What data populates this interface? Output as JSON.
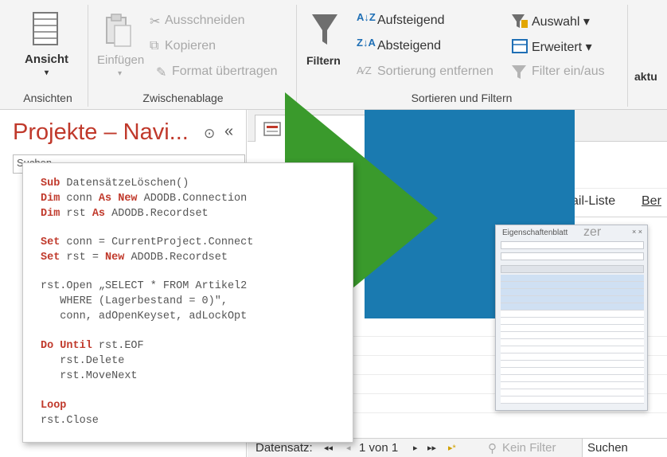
{
  "ribbon": {
    "ansicht": "Ansicht",
    "einfuegen": "Einfügen",
    "ausschneiden": "Ausschneiden",
    "kopieren": "Kopieren",
    "format_uebertragen": "Format übertragen",
    "filtern": "Filtern",
    "aufsteigend": "Aufsteigend",
    "absteigend": "Absteigend",
    "sortierung_entfernen": "Sortierung entfernen",
    "auswahl": "Auswahl ▾",
    "erweitert": "Erweitert ▾",
    "filter_ein_aus": "Filter ein/aus",
    "aktu": "aktu",
    "groups": {
      "ansichten": "Ansichten",
      "zwischenablage": "Zwischenablage",
      "sortieren_filtern": "Sortieren und Filtern"
    }
  },
  "nav": {
    "title": "Projekte – Navi...",
    "search_placeholder": "Suchen",
    "chevron": "⊙",
    "collapse": "«"
  },
  "tabs": {
    "email_liste": "ail-Liste",
    "ber": "Ber"
  },
  "statusbar": {
    "datensatz_label": "Datensatz:",
    "first": "◂◂",
    "prev": "◂",
    "position": "1 von 1",
    "next": "▸",
    "last": "▸▸",
    "new": "▸*",
    "kein_filter": "Kein Filter",
    "suchen": "Suchen"
  },
  "property_sheet": {
    "title": "Eigenschaftenblatt",
    "big_title": "zer",
    "close": "× ×"
  },
  "code": {
    "line1_kw": "Sub",
    "line1_rest": " DatensätzeLöschen()",
    "line2_kw": "Dim",
    "line2_mid": " conn ",
    "line2_kw2": "As New",
    "line2_rest": " ADODB.Connection",
    "line3_kw": "Dim",
    "line3_mid": " rst ",
    "line3_kw2": "As",
    "line3_rest": " ADODB.Recordset",
    "line4_kw": "Set",
    "line4_rest": " conn = CurrentProject.Connect",
    "line5_kw": "Set",
    "line5_mid": " rst = ",
    "line5_kw2": "New",
    "line5_rest": " ADODB.Recordset",
    "line6": "rst.Open „SELECT * FROM Artikel2",
    "line7": "   WHERE (Lagerbestand = 0)\",",
    "line8": "   conn, adOpenKeyset, adLockOpt",
    "line9_kw": "Do Until",
    "line9_rest": " rst.EOF",
    "line10": "   rst.Delete",
    "line11": "   rst.MoveNext",
    "line12_kw": "Loop",
    "line13": "rst.Close"
  },
  "colors": {
    "accent_red": "#c0392b",
    "form_blue": "#1a7ab0",
    "play_green": "#3a9a2c"
  }
}
